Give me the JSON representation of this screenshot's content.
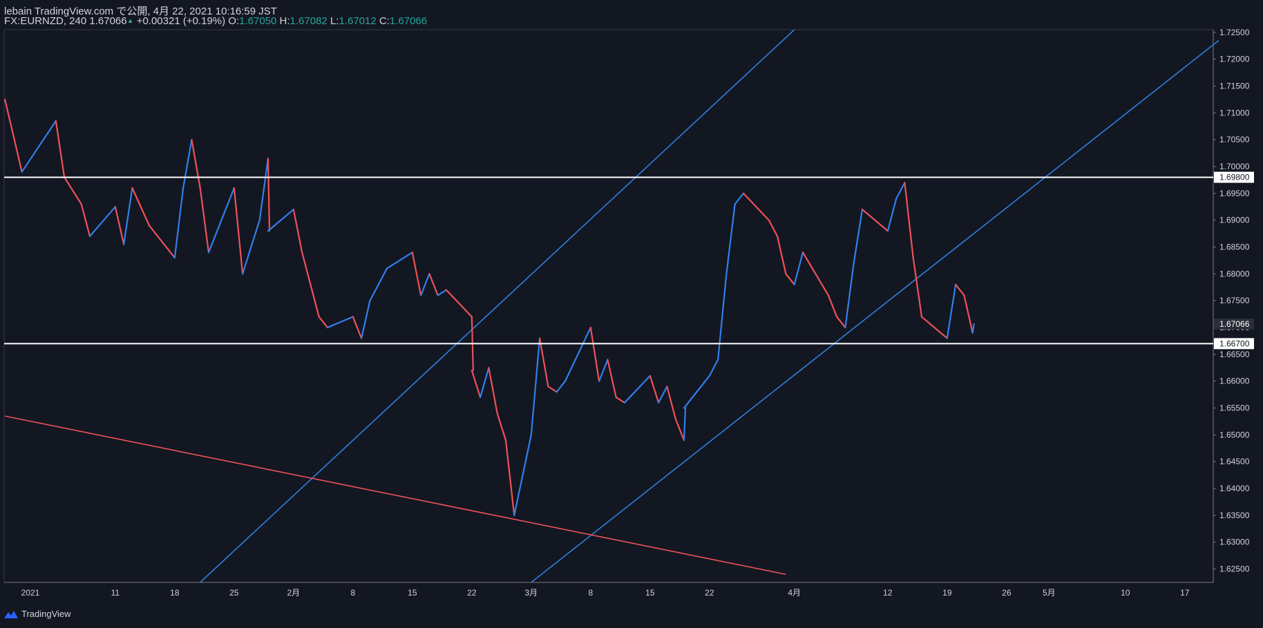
{
  "header": {
    "publish_line": "lebain TradingView.com で公開, 4月 22, 2021 10:16:59 JST",
    "symbol_interval": "FX:EURNZD, 240",
    "last_price": "1.67066",
    "change": "+0.00321 (+0.19%)",
    "open_label": "O:",
    "open": "1.67050",
    "high_label": "H:",
    "high": "1.67082",
    "low_label": "L:",
    "low": "1.67012",
    "close_label": "C:",
    "close": "1.67066"
  },
  "footer": {
    "brand": "TradingView"
  },
  "colors": {
    "background": "#131722",
    "up": "#2f80ed",
    "down": "#f0515a",
    "trend_blue": "#2e7fe0",
    "trend_red": "#f0515a",
    "level_line": "#ffffff",
    "axis_text": "#d1d4dc",
    "change_green": "#26a69a"
  },
  "chart_data": {
    "type": "candlestick",
    "symbol": "FX:EURNZD",
    "interval": "240",
    "ylim": [
      1.6225,
      1.7255
    ],
    "y_ticks": [
      "1.62500",
      "1.63000",
      "1.63500",
      "1.64000",
      "1.64500",
      "1.65000",
      "1.65500",
      "1.66000",
      "1.66500",
      "1.67000",
      "1.67500",
      "1.68000",
      "1.68500",
      "1.69000",
      "1.69500",
      "1.70000",
      "1.70500",
      "1.71000",
      "1.71500",
      "1.72000",
      "1.72500"
    ],
    "x_ticks": [
      {
        "label": "2021",
        "date": "2021-01-01"
      },
      {
        "label": "11",
        "date": "2021-01-11"
      },
      {
        "label": "18",
        "date": "2021-01-18"
      },
      {
        "label": "25",
        "date": "2021-01-25"
      },
      {
        "label": "2月",
        "date": "2021-02-01"
      },
      {
        "label": "8",
        "date": "2021-02-08"
      },
      {
        "label": "15",
        "date": "2021-02-15"
      },
      {
        "label": "22",
        "date": "2021-02-22"
      },
      {
        "label": "3月",
        "date": "2021-03-01"
      },
      {
        "label": "8",
        "date": "2021-03-08"
      },
      {
        "label": "15",
        "date": "2021-03-15"
      },
      {
        "label": "22",
        "date": "2021-03-22"
      },
      {
        "label": "4月",
        "date": "2021-04-01"
      },
      {
        "label": "12",
        "date": "2021-04-12"
      },
      {
        "label": "19",
        "date": "2021-04-19"
      },
      {
        "label": "26",
        "date": "2021-04-26"
      },
      {
        "label": "5月",
        "date": "2021-05-01"
      },
      {
        "label": "10",
        "date": "2021-05-10"
      },
      {
        "label": "17",
        "date": "2021-05-17"
      }
    ],
    "price_path": [
      [
        "2020-12-29",
        1.7125
      ],
      [
        "2020-12-31",
        1.699
      ],
      [
        "2021-01-04",
        1.7085
      ],
      [
        "2021-01-05",
        1.698
      ],
      [
        "2021-01-07",
        1.693
      ],
      [
        "2021-01-08",
        1.687
      ],
      [
        "2021-01-11",
        1.6925
      ],
      [
        "2021-01-12",
        1.6855
      ],
      [
        "2021-01-13",
        1.696
      ],
      [
        "2021-01-15",
        1.689
      ],
      [
        "2021-01-18",
        1.683
      ],
      [
        "2021-01-19",
        1.696
      ],
      [
        "2021-01-20",
        1.705
      ],
      [
        "2021-01-21",
        1.696
      ],
      [
        "2021-01-22",
        1.684
      ],
      [
        "2021-01-25",
        1.696
      ],
      [
        "2021-01-26",
        1.68
      ],
      [
        "2021-01-28",
        1.69
      ],
      [
        "2021-01-29",
        1.7015
      ],
      [
        "2021-01-29",
        1.688
      ],
      [
        "2021-02-01",
        1.692
      ],
      [
        "2021-02-02",
        1.684
      ],
      [
        "2021-02-03",
        1.678
      ],
      [
        "2021-02-04",
        1.672
      ],
      [
        "2021-02-05",
        1.67
      ],
      [
        "2021-02-08",
        1.672
      ],
      [
        "2021-02-09",
        1.668
      ],
      [
        "2021-02-10",
        1.675
      ],
      [
        "2021-02-12",
        1.681
      ],
      [
        "2021-02-15",
        1.684
      ],
      [
        "2021-02-16",
        1.676
      ],
      [
        "2021-02-17",
        1.68
      ],
      [
        "2021-02-18",
        1.676
      ],
      [
        "2021-02-19",
        1.677
      ],
      [
        "2021-02-22",
        1.672
      ],
      [
        "2021-02-22",
        1.662
      ],
      [
        "2021-02-23",
        1.657
      ],
      [
        "2021-02-24",
        1.6625
      ],
      [
        "2021-02-25",
        1.654
      ],
      [
        "2021-02-26",
        1.649
      ],
      [
        "2021-02-27",
        1.635
      ],
      [
        "2021-03-01",
        1.65
      ],
      [
        "2021-03-02",
        1.668
      ],
      [
        "2021-03-03",
        1.659
      ],
      [
        "2021-03-04",
        1.658
      ],
      [
        "2021-03-05",
        1.66
      ],
      [
        "2021-03-08",
        1.67
      ],
      [
        "2021-03-09",
        1.66
      ],
      [
        "2021-03-10",
        1.664
      ],
      [
        "2021-03-11",
        1.657
      ],
      [
        "2021-03-12",
        1.656
      ],
      [
        "2021-03-15",
        1.661
      ],
      [
        "2021-03-16",
        1.656
      ],
      [
        "2021-03-17",
        1.659
      ],
      [
        "2021-03-18",
        1.653
      ],
      [
        "2021-03-19",
        1.649
      ],
      [
        "2021-03-19",
        1.655
      ],
      [
        "2021-03-22",
        1.661
      ],
      [
        "2021-03-23",
        1.664
      ],
      [
        "2021-03-24",
        1.68
      ],
      [
        "2021-03-25",
        1.693
      ],
      [
        "2021-03-26",
        1.695
      ],
      [
        "2021-03-29",
        1.69
      ],
      [
        "2021-03-30",
        1.687
      ],
      [
        "2021-03-31",
        1.68
      ],
      [
        "2021-04-01",
        1.678
      ],
      [
        "2021-04-02",
        1.684
      ],
      [
        "2021-04-05",
        1.676
      ],
      [
        "2021-04-06",
        1.672
      ],
      [
        "2021-04-07",
        1.67
      ],
      [
        "2021-04-08",
        1.682
      ],
      [
        "2021-04-09",
        1.692
      ],
      [
        "2021-04-12",
        1.688
      ],
      [
        "2021-04-13",
        1.694
      ],
      [
        "2021-04-14",
        1.697
      ],
      [
        "2021-04-15",
        1.683
      ],
      [
        "2021-04-16",
        1.672
      ],
      [
        "2021-04-19",
        1.668
      ],
      [
        "2021-04-20",
        1.678
      ],
      [
        "2021-04-21",
        1.676
      ],
      [
        "2021-04-22",
        1.669
      ],
      [
        "2021-04-22",
        1.67066
      ]
    ],
    "horizontal_levels": [
      1.698,
      1.667
    ],
    "price_labels": [
      {
        "value": 1.698,
        "text": "1.69800"
      },
      {
        "value": 1.67066,
        "text": "1.67066"
      },
      {
        "value": 1.667,
        "text": "1.66700"
      }
    ],
    "trend_lines": [
      {
        "color": "blue",
        "from": [
          "2021-01-21",
          1.6225
        ],
        "to": [
          "2021-04-01",
          1.7255
        ]
      },
      {
        "color": "blue",
        "from": [
          "2021-03-01",
          1.6225
        ],
        "to": [
          "2021-05-21",
          1.7235
        ]
      },
      {
        "color": "red",
        "from": [
          "2020-12-29",
          1.6535
        ],
        "to": [
          "2021-03-31",
          1.624
        ]
      }
    ]
  }
}
